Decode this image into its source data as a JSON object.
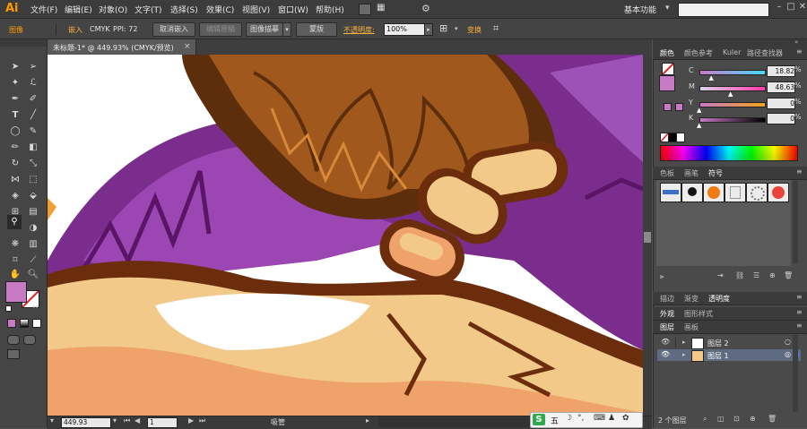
{
  "app": {
    "logo": "Ai"
  },
  "menu": [
    "文件(F)",
    "编辑(E)",
    "对象(O)",
    "文字(T)",
    "选择(S)",
    "效果(C)",
    "视图(V)",
    "窗口(W)",
    "帮助(H)"
  ],
  "workspace": {
    "label": "基本功能"
  },
  "control": {
    "label": "图像",
    "embed": "嵌入",
    "color_mode": "CMYK",
    "ppi": "PPI: 72",
    "cancel_embed": "取消嵌入",
    "edit_original": "编辑原稿",
    "image_trace": "图像描摹",
    "mask": "蒙版",
    "opacity_label": "不透明度:",
    "opacity_value": "100%",
    "transform": "变换"
  },
  "document": {
    "tab_title": "未标题-1* @ 449.93% (CMYK/预览)"
  },
  "status": {
    "zoom": "449.93",
    "page": "1",
    "tool": "吸管"
  },
  "panels": {
    "color_tabs": [
      "颜色",
      "颜色参考",
      "Kuler",
      "路径查找器"
    ],
    "channels": [
      {
        "name": "C",
        "value": "18.82",
        "fraction": 0.188,
        "track": "#ff44b0"
      },
      {
        "name": "M",
        "value": "48.63",
        "fraction": 0.486,
        "track": "#ff3f9a"
      },
      {
        "name": "Y",
        "value": "0",
        "fraction": 0,
        "track": "#f4a21c"
      },
      {
        "name": "K",
        "value": "0",
        "fraction": 0,
        "track": "#000000"
      }
    ],
    "current_color": "#c77ac4",
    "symbols_tabs": [
      "色板",
      "画笔",
      "符号"
    ],
    "appearance_tabs": [
      "描边",
      "渐变",
      "透明度"
    ],
    "layers_tabs": [
      "外观",
      "图形样式"
    ],
    "layers_subtabs": [
      "图层",
      "画板"
    ],
    "layers": [
      {
        "name": "图层 2",
        "selected": false
      },
      {
        "name": "图层 1",
        "selected": true
      }
    ],
    "layer_count": "2 个图层"
  },
  "ime": {
    "label": "五"
  }
}
